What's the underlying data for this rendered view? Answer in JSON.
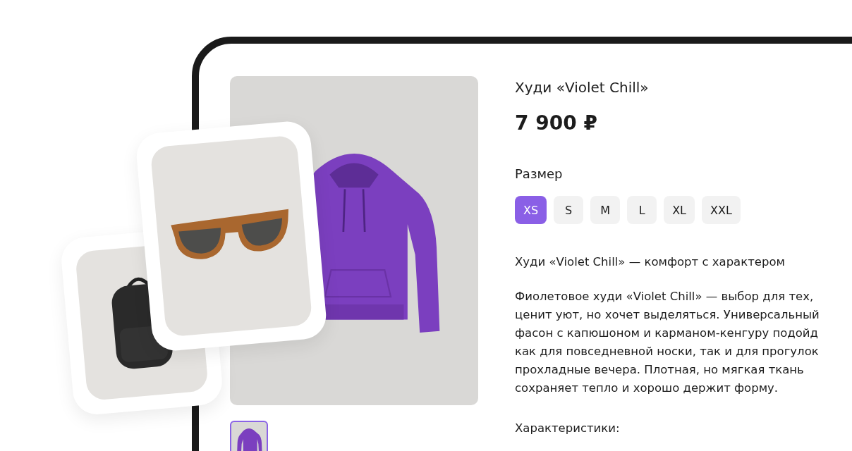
{
  "product": {
    "title": "Худи «Violet Chill»",
    "price": "7 900 ₽"
  },
  "gallery": {
    "thumbnails": [
      {
        "selected": true
      }
    ]
  },
  "size_picker": {
    "label": "Размер",
    "sizes": [
      {
        "label": "XS",
        "selected": true
      },
      {
        "label": "S",
        "selected": false
      },
      {
        "label": "M",
        "selected": false
      },
      {
        "label": "L",
        "selected": false
      },
      {
        "label": "XL",
        "selected": false
      },
      {
        "label": "XXL",
        "selected": false
      }
    ]
  },
  "description": {
    "heading": "Худи «Violet Chill» — комфорт с характером",
    "lines": [
      "Фиолетовое худи «Violet Chill» — выбор для тех,",
      "ценит уют, но хочет выделяться. Универсальный",
      "фасон с капюшоном и карманом-кенгуру подойд",
      "как для повседневной носки, так и для прогулок",
      "прохладные вечера. Плотная, но мягкая ткань",
      "сохраняет тепло и хорошо держит форму."
    ]
  },
  "specs": {
    "heading": "Характеристики:"
  }
}
